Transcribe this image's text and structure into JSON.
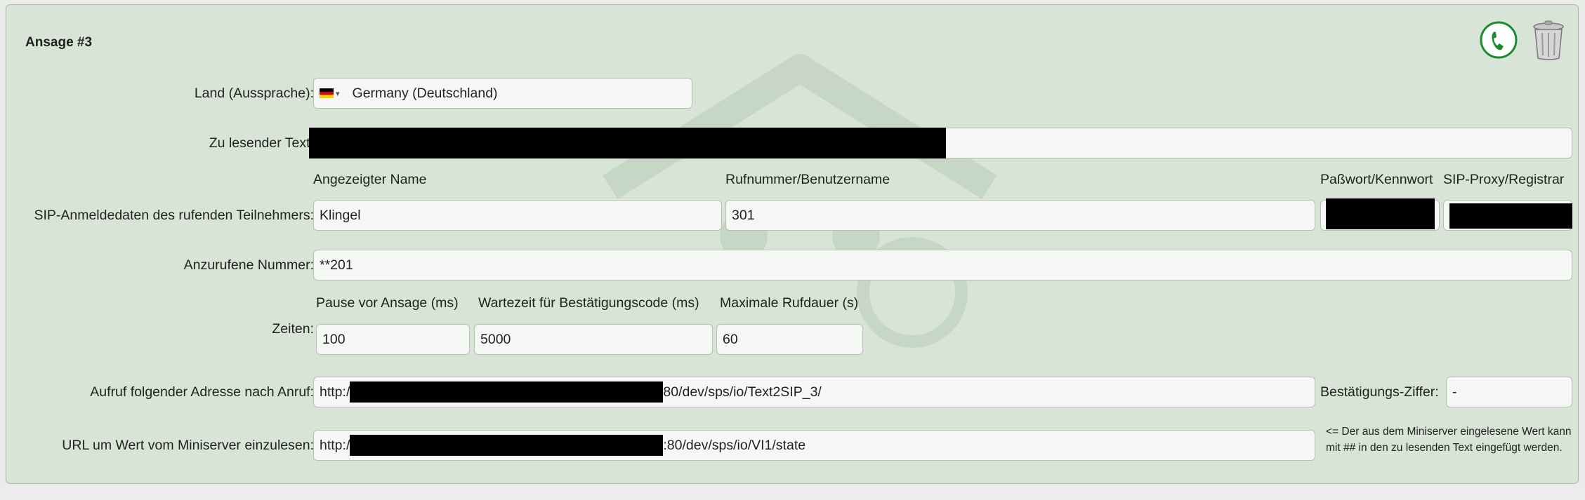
{
  "section": {
    "title": "Ansage #3"
  },
  "labels": {
    "country": "Land (Aussprache):",
    "text": "Zu lesender Text:",
    "sip": "SIP-Anmeldedaten des rufenden Teilnehmers:",
    "number": "Anzurufene Nummer:",
    "times": "Zeiten:",
    "callurl": "Aufruf folgender Adresse nach Anruf:",
    "readurl": "URL um Wert vom Miniserver einzulesen:",
    "confirm_digit": "Bestätigungs-Ziffer:"
  },
  "country": {
    "value": "Germany (Deutschland)",
    "flag": "DE",
    "caret": "▾"
  },
  "sip": {
    "col_name": "Angezeigter Name",
    "col_user": "Rufnummer/Benutzername",
    "col_pass": "Paßwort/Kennwort",
    "col_proxy": "SIP-Proxy/Registrar",
    "name": "Klingel",
    "user": "301"
  },
  "number": {
    "value": "**201"
  },
  "times": {
    "col_pause": "Pause vor Ansage (ms)",
    "col_wait": "Wartezeit für Bestätigungscode (ms)",
    "col_max": "Maximale Rufdauer (s)",
    "pause": "100",
    "wait": "5000",
    "max": "60"
  },
  "callurl": {
    "prefix": "http:/",
    "suffix": "80/dev/sps/io/Text2SIP_3/"
  },
  "confirm": {
    "value": "-"
  },
  "readurl": {
    "prefix": "http:/",
    "suffix": ":80/dev/sps/io/VI1/state"
  },
  "note": "<= Der aus dem Miniserver eingelesene Wert kann mit ## in den zu lesenden Text eingefügt werden.",
  "icons": {
    "phone": "phone-icon",
    "trash": "trash-icon"
  },
  "colors": {
    "panel": "#d8e5d6",
    "accent": "#1e8a2e"
  }
}
